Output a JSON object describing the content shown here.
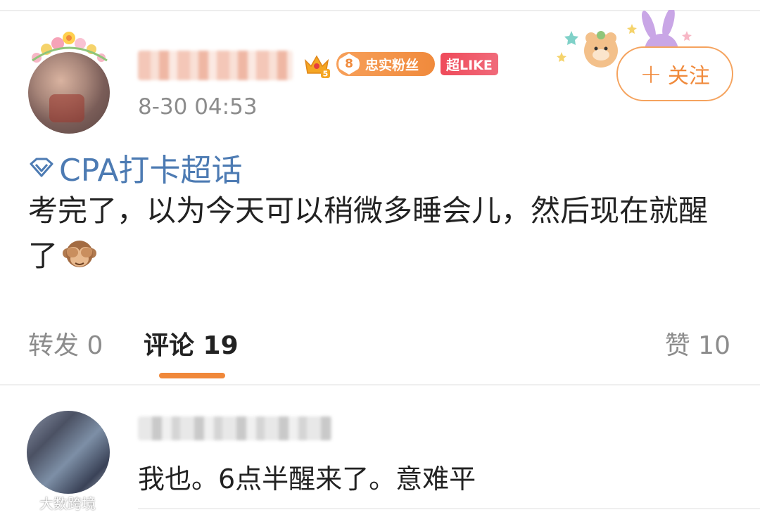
{
  "post": {
    "time": "8-30 04:53",
    "fan_level": "8",
    "fan_badge": "忠实粉丝",
    "like_badge": "超LIKE",
    "crown_level": "5",
    "follow_label": "关注",
    "follow_plus": "+",
    "topic": "CPA打卡超话",
    "text": "考完了，以为今天可以稍微多睡会儿，然后现在就醒了"
  },
  "tabs": {
    "repost": "转发 0",
    "comment": "评论 19",
    "like": "赞 10"
  },
  "comment": {
    "text": "我也。6点半醒来了。意难平"
  },
  "watermark": {
    "text": "大数跨境"
  },
  "colors": {
    "accent": "#f08a3c",
    "topic": "#4d7bb3",
    "like_badge": "#ef4a5a",
    "secondary_text": "#8c8c8c"
  }
}
